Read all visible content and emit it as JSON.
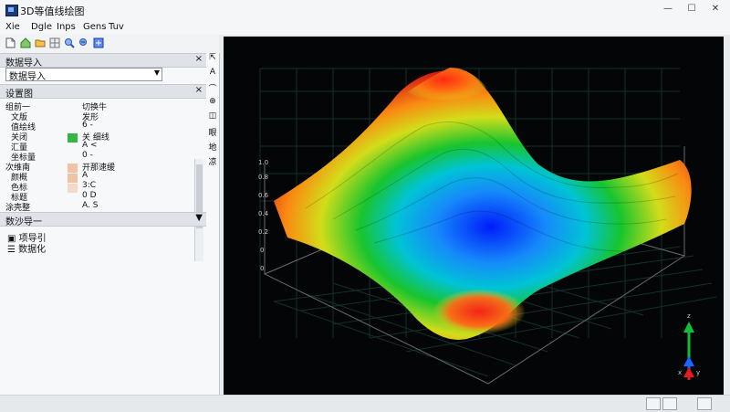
{
  "window": {
    "title": "3D等值线绘图",
    "buttons": [
      "—",
      "☐",
      "✕"
    ]
  },
  "menu": [
    "Xie",
    "Dgle",
    "Inps",
    "Gens",
    "Tuv"
  ],
  "toolbar": {
    "icons": [
      "open-file-icon",
      "home-icon",
      "folder-icon",
      "grid-icon",
      "zoom-in-icon",
      "zoom-out-icon",
      "export-icon"
    ]
  },
  "left_panel": {
    "import_header": "数据导入",
    "import_combo": "数据导入",
    "settings_header": "设置图",
    "list_left": [
      "组前一",
      "文版",
      "值绘线",
      "关闭",
      "汇量",
      "坐标量",
      "次维南",
      "颜概",
      "色标",
      "标题",
      "涂壳整"
    ],
    "list_right": [
      "切换牛",
      "发形",
      "6 -",
      "关 细线",
      "A <",
      "0 -",
      "开那速缓",
      "A",
      "3:C",
      "0 D",
      "A. S"
    ],
    "bottom_header": "数沙导一",
    "bottom_items": [
      "项导引",
      "数据化"
    ]
  },
  "side_icons": [
    "⇱",
    "A",
    "⌒",
    "⊕",
    "◫",
    "眼",
    "地",
    "凉"
  ],
  "colors": {
    "viewport_bg": "#030507",
    "grid": "#1a3b33",
    "accent_green": "#0fbf38",
    "accent_blue": "#1a67ff",
    "accent_red": "#e61b1b"
  },
  "axis_gizmo": {
    "labels": [
      "z",
      "x",
      "y"
    ]
  }
}
